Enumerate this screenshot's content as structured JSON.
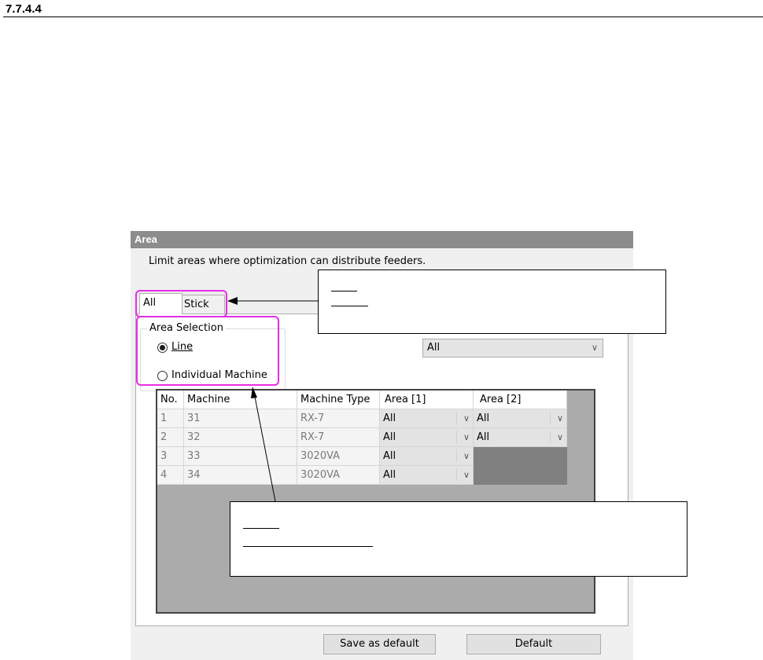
{
  "document": {
    "section_number": "7.7.4.4"
  },
  "panel": {
    "title": "Area",
    "description": "Limit areas where optimization can distribute feeders.",
    "tabs": [
      {
        "label": "All",
        "active": true
      },
      {
        "label": "Stick",
        "active": false
      }
    ],
    "area_selection": {
      "label": "Area Selection",
      "options": [
        {
          "label": "Line",
          "checked": true
        },
        {
          "label": "Individual Machine",
          "checked": false
        }
      ]
    },
    "line_area_select": {
      "value": "All"
    },
    "grid": {
      "columns": [
        "No.",
        "Machine",
        "Machine Type",
        "Area [1]",
        "Area [2]"
      ],
      "rows": [
        {
          "no": "1",
          "machine": "31",
          "type": "RX-7",
          "area1": "All",
          "area2": "All"
        },
        {
          "no": "2",
          "machine": "32",
          "type": "RX-7",
          "area1": "All",
          "area2": "All"
        },
        {
          "no": "3",
          "machine": "33",
          "type": "3020VA",
          "area1": "All",
          "area2": ""
        },
        {
          "no": "4",
          "machine": "34",
          "type": "3020VA",
          "area1": "All",
          "area2": ""
        }
      ]
    },
    "buttons": {
      "save_default": "Save as default",
      "default": "Default"
    }
  },
  "colors": {
    "highlight": "#e62ee6",
    "title_bar": "#8c8c8c"
  }
}
